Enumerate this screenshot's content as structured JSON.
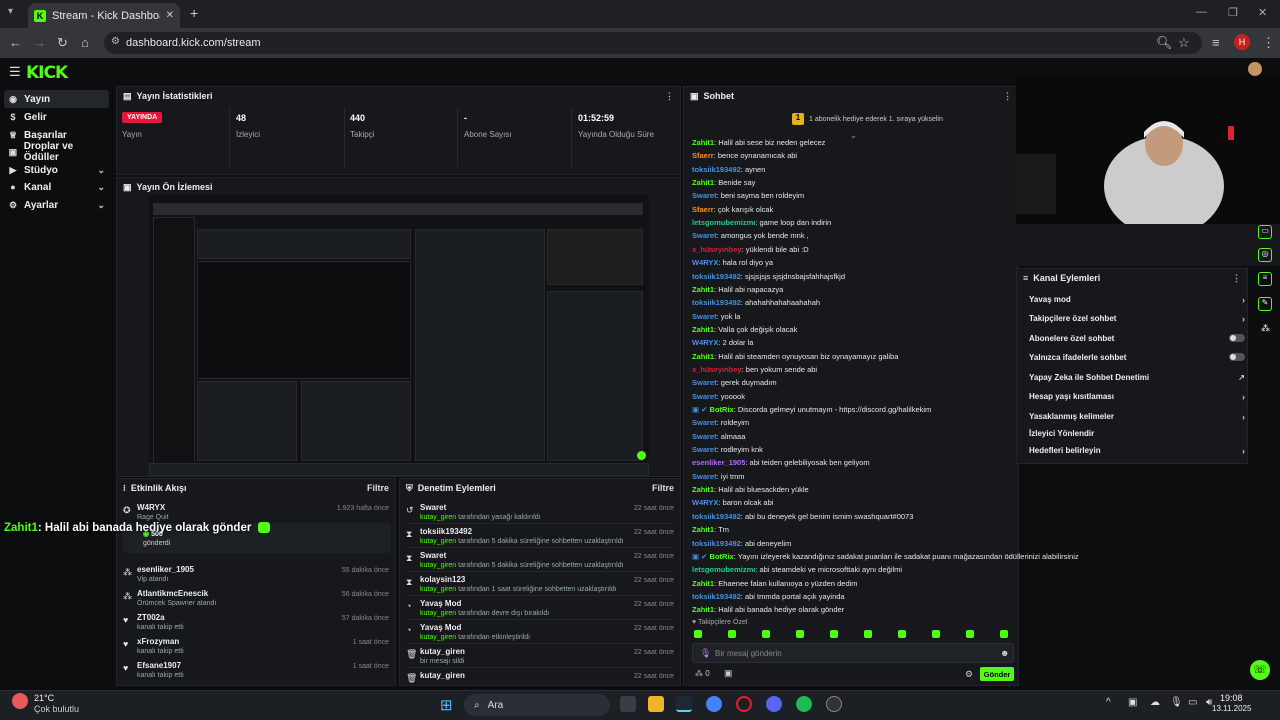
{
  "browser": {
    "tab_title": "Stream - Kick Dashboard",
    "url": "dashboard.kick.com/stream",
    "profile_initial": "H"
  },
  "header": {
    "logo": "KICK"
  },
  "sidebar": {
    "items": [
      {
        "label": "Yayın",
        "icon": "broadcast-icon",
        "active": true
      },
      {
        "label": "Gelir",
        "icon": "money-icon"
      },
      {
        "label": "Başarılar",
        "icon": "trophy-icon"
      },
      {
        "label": "Droplar ve Ödüller",
        "icon": "gift-icon"
      },
      {
        "label": "Stüdyo",
        "icon": "studio-icon",
        "expandable": true
      },
      {
        "label": "Kanal",
        "icon": "user-icon",
        "expandable": true
      },
      {
        "label": "Ayarlar",
        "icon": "gear-icon",
        "expandable": true
      }
    ]
  },
  "stats": {
    "title": "Yayın İstatistikleri",
    "live_badge": "YAYINDA",
    "live_label": "Yayın",
    "viewers": {
      "value": "48",
      "label": "İzleyici"
    },
    "followers": {
      "value": "440",
      "label": "Takipçi"
    },
    "subs": {
      "value": "-",
      "label": "Abone Sayısı"
    },
    "uptime": {
      "value": "01:52:59",
      "label": "Yayında Olduğu Süre"
    }
  },
  "preview": {
    "title": "Yayın Ön İzlemesi"
  },
  "activity": {
    "title": "Etkinlik Akışı",
    "filter": "Filtre",
    "items": [
      {
        "name": "W4RYX",
        "sub": "Rage Quit",
        "time": "1.923 hafta önce",
        "icon": "gift-icon"
      },
      {
        "name": "esenliker_1905",
        "sub": "Vip atandı",
        "time": "55 dakika önce",
        "icon": "badge-icon"
      },
      {
        "name": "AtlantikmcEnescik",
        "sub": "Örümcek Spawner atandı",
        "time": "56 dakika önce",
        "icon": "badge-icon"
      },
      {
        "name": "ZT002a",
        "sub": "kanalı takip etti",
        "time": "57 dakika önce",
        "icon": "heart-icon"
      },
      {
        "name": "xFrozyman",
        "sub": "kanalı takip etti",
        "time": "1 saat önce",
        "icon": "heart-icon"
      },
      {
        "name": "Efsane1907",
        "sub": "kanalı takip etti",
        "time": "1 saat önce",
        "icon": "heart-icon"
      }
    ],
    "gift_amount": "500",
    "gift_sent": "gönderdi"
  },
  "overlay_message": {
    "user": "Zahit1",
    "text": ": Halil abi banada hediye olarak gönder"
  },
  "moderation": {
    "title": "Denetim Eylemleri",
    "filter": "Filtre",
    "items": [
      {
        "name": "Swaret",
        "actor": "kutay_giren",
        "desc": "tarafından yasağı kaldırıldı",
        "time": "22 saat önce",
        "icon": "unban-icon"
      },
      {
        "name": "toksiik193492",
        "actor": "kutay_giren",
        "desc": "tarafından 5 dakika süreliğine sohbetten uzaklaştırıldı",
        "time": "22 saat önce",
        "icon": "timeout-icon"
      },
      {
        "name": "Swaret",
        "actor": "kutay_giren",
        "desc": "tarafından 5 dakika süreliğine sohbetten uzaklaştırıldı",
        "time": "22 saat önce",
        "icon": "timeout-icon"
      },
      {
        "name": "kolaysin123",
        "actor": "kutay_giren",
        "desc": "tarafından 1 saat süreliğine sohbetten uzaklaştırıldı",
        "time": "22 saat önce",
        "icon": "timeout-icon"
      },
      {
        "name": "Yavaş Mod",
        "actor": "kutay_giren",
        "desc": "tarafından devre dışı bırakıldı",
        "time": "22 saat önce",
        "icon": "slow-icon"
      },
      {
        "name": "Yavaş Mod",
        "actor": "kutay_giren",
        "desc": "tarafından etkinleştirildi",
        "time": "22 saat önce",
        "icon": "slow-icon"
      },
      {
        "name": "kutay_giren",
        "actor": "",
        "desc": "bir mesajı sildi",
        "time": "22 saat önce",
        "icon": "trash-icon"
      },
      {
        "name": "kutay_giren",
        "actor": "",
        "desc": "",
        "time": "22 saat önce",
        "icon": "trash-icon"
      }
    ]
  },
  "chat": {
    "title": "Sohbet",
    "banner": "1 abonelik hediye ederek 1. sıraya yükselin",
    "messages": [
      {
        "user": "Zahit1",
        "color": "#53fc18",
        "text": ": Halil abi sese biz neden gelecez"
      },
      {
        "user": "Sfaerr",
        "color": "#ff8c1a",
        "text": ": bence oynanamıcak abi"
      },
      {
        "user": "toksiik193492",
        "color": "#4a90e2",
        "text": ": aynen"
      },
      {
        "user": "Zahit1",
        "color": "#53fc18",
        "text": ": Benide say"
      },
      {
        "user": "Swaret",
        "color": "#4a90e2",
        "text": ": beni sayma ben roldeyim"
      },
      {
        "user": "Sfaerr",
        "color": "#ff8c1a",
        "text": ": çok karışık olcak"
      },
      {
        "user": "letsgomubemizmı",
        "color": "#1fcf83",
        "text": ": game loop dan indirin"
      },
      {
        "user": "Swaret",
        "color": "#4a90e2",
        "text": ": amongus yok bende mnk ,"
      },
      {
        "user": "x_hüseyinbey",
        "color": "#e3173d",
        "text": ": yüklendi bile abi :D"
      },
      {
        "user": "W4RYX",
        "color": "#4a90e2",
        "text": ": hala rol diyo ya"
      },
      {
        "user": "toksiik193492",
        "color": "#4a90e2",
        "text": ": sjsjsjsjs sjsjdnsbajsfahhajsfkjd"
      },
      {
        "user": "Zahit1",
        "color": "#53fc18",
        "text": ": Halil abi napacazya"
      },
      {
        "user": "toksiik193492",
        "color": "#4a90e2",
        "text": ": ahahahhahahaahahah"
      },
      {
        "user": "Swaret",
        "color": "#4a90e2",
        "text": ": yok la"
      },
      {
        "user": "Zahit1",
        "color": "#53fc18",
        "text": ": Valla çok değişik olacak"
      },
      {
        "user": "W4RYX",
        "color": "#4a90e2",
        "text": ": 2 dolar la"
      },
      {
        "user": "Zahit1",
        "color": "#53fc18",
        "text": ": Halil abi steamden oynuyosan biz oynayamayız galiba"
      },
      {
        "user": "x_hüseyinbey",
        "color": "#e3173d",
        "text": ": ben yokum sende abi"
      },
      {
        "user": "Swaret",
        "color": "#4a90e2",
        "text": ": gerek duymadım"
      },
      {
        "user": "Swaret",
        "color": "#4a90e2",
        "text": ": yooook"
      },
      {
        "user": "BotRix",
        "color": "#53fc18",
        "text": ": Discorda gelmeyi unutmayın - https://discord.gg/halilkekim",
        "bot": true
      },
      {
        "user": "Swaret",
        "color": "#4a90e2",
        "text": ": roldeyim"
      },
      {
        "user": "Swaret",
        "color": "#4a90e2",
        "text": ": almaaa"
      },
      {
        "user": "Swaret",
        "color": "#4a90e2",
        "text": ": rodleyim knk"
      },
      {
        "user": "esenliker_1905",
        "color": "#b36bff",
        "text": ": abi teiden gelebiliyosak ben geliyom"
      },
      {
        "user": "Swaret",
        "color": "#4a90e2",
        "text": ": iyi tmm"
      },
      {
        "user": "Zahit1",
        "color": "#53fc18",
        "text": ": Halil abi bluesackden yükle"
      },
      {
        "user": "W4RYX",
        "color": "#4a90e2",
        "text": ": baron olcak abi"
      },
      {
        "user": "toksiik193492",
        "color": "#4a90e2",
        "text": ": abi bu deneyek gel benim ismim swashquart#0073"
      },
      {
        "user": "Zahit1",
        "color": "#53fc18",
        "text": ": Tm"
      },
      {
        "user": "toksiik193492",
        "color": "#4a90e2",
        "text": ": abi deneyelim"
      },
      {
        "user": "BotRix",
        "color": "#53fc18",
        "text": ": Yayını izleyerek kazandığınız sadakat puanları ile sadakat puanı mağazasından ödüllerinizi alabilirsiniz",
        "bot": true
      },
      {
        "user": "letsgomubemizmı",
        "color": "#1fcf83",
        "text": ": abi steamdeki ve microsofttaki aynı değilmi"
      },
      {
        "user": "Zahit1",
        "color": "#53fc18",
        "text": ": Ehaenee falan kullanıoya o yüzden dedim"
      },
      {
        "user": "toksiik193492",
        "color": "#4a90e2",
        "text": ": abi tmmda portal açık yayinda"
      },
      {
        "user": "Zahit1",
        "color": "#53fc18",
        "text": ": Halil abi banada hediye olarak gönder"
      }
    ],
    "followers_only": "Takipçilere Özel",
    "input_placeholder": "Bir mesaj gönderin",
    "send_label": "Gönder",
    "points_label": "0"
  },
  "channel_actions": {
    "title": "Kanal Eylemleri",
    "items": [
      {
        "label": "Yavaş mod",
        "control": "arrow"
      },
      {
        "label": "Takipçilere özel sohbet",
        "control": "arrow"
      },
      {
        "label": "Abonelere özel sohbet",
        "control": "toggle"
      },
      {
        "label": "Yalnızca ifadelerle sohbet",
        "control": "toggle"
      },
      {
        "label": "Yapay Zeka ile Sohbet Denetimi",
        "control": "external"
      },
      {
        "label": "Hesap yaşı kısıtlaması",
        "control": "arrow"
      },
      {
        "label": "Yasaklanmış kelimeler",
        "control": "arrow"
      },
      {
        "label": "İzleyici Yönlendir",
        "control": "none"
      },
      {
        "label": "Hedefleri belirleyin",
        "control": "arrow"
      }
    ]
  },
  "taskbar": {
    "weather_temp": "21°C",
    "weather_desc": "Çok bulutlu",
    "search_label": "Ara",
    "time": "19:08",
    "date": "13.11.2025"
  },
  "colors": {
    "kick_green": "#53fc18",
    "live_red": "#e3173d",
    "panel_bg": "#16181b"
  }
}
